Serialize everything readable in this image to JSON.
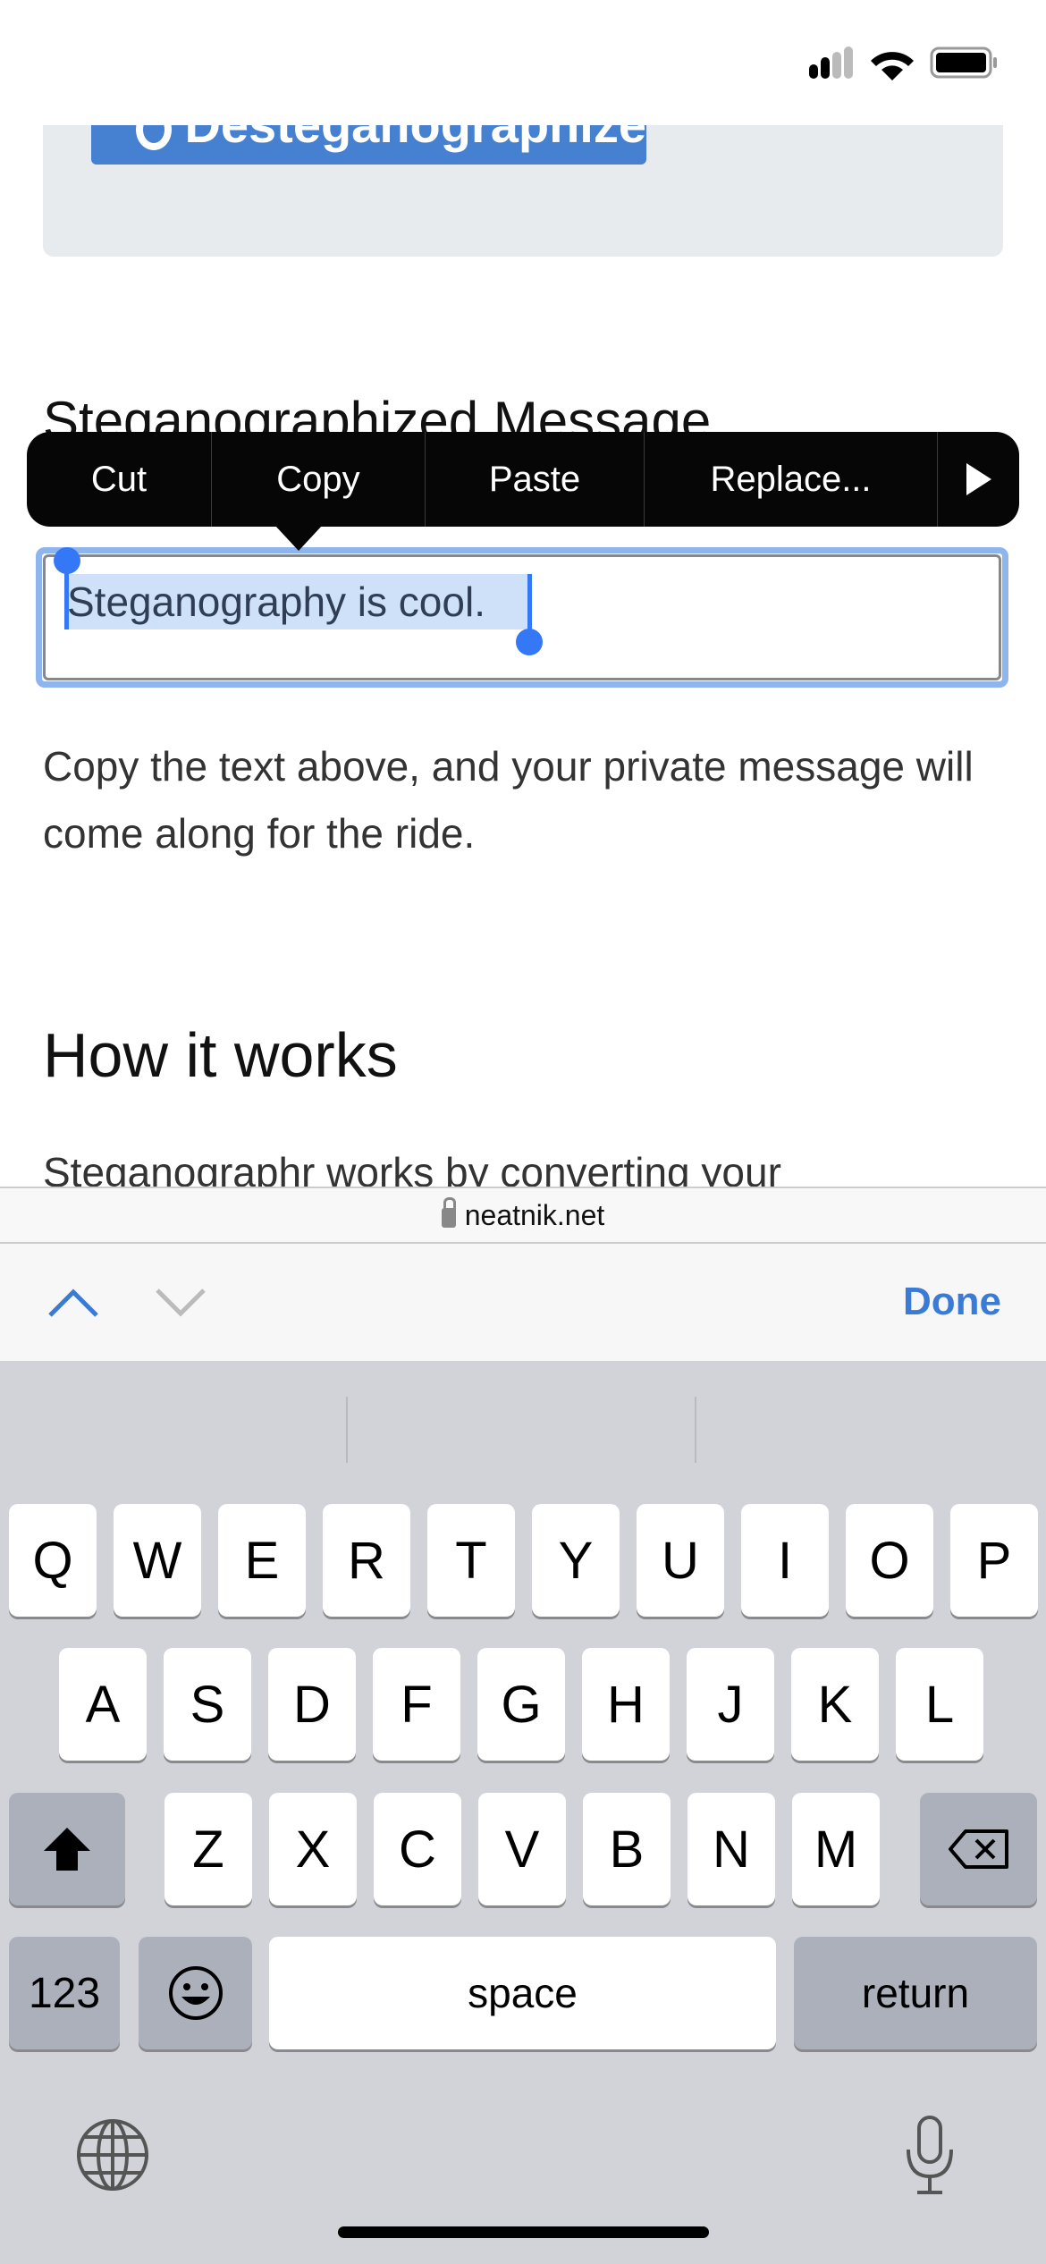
{
  "status_bar": {
    "icons": [
      "signal-icon",
      "wifi-icon",
      "battery-icon"
    ]
  },
  "page": {
    "desteganographize_button": "Desteganographize",
    "heading_message": "Steganographized Message",
    "field_value": "Steganography is cool.",
    "description": "Copy the text above, and your private message will come along for the ride.",
    "heading_how": "How it works",
    "how_text": "Steganographr works by converting your"
  },
  "context_menu": {
    "items": [
      "Cut",
      "Copy",
      "Paste",
      "Replace..."
    ],
    "more_icon": "play-arrow-icon"
  },
  "address_bar": {
    "domain": "neatnik.net",
    "icon": "lock-icon"
  },
  "toolbar": {
    "done": "Done",
    "prev_icon": "chevron-up-icon",
    "next_icon": "chevron-down-icon"
  },
  "keyboard": {
    "row1": [
      "Q",
      "W",
      "E",
      "R",
      "T",
      "Y",
      "U",
      "I",
      "O",
      "P"
    ],
    "row2": [
      "A",
      "S",
      "D",
      "F",
      "G",
      "H",
      "J",
      "K",
      "L"
    ],
    "row3": [
      "Z",
      "X",
      "C",
      "V",
      "B",
      "N",
      "M"
    ],
    "numbers": "123",
    "space": "space",
    "return": "return"
  },
  "colors": {
    "accent": "#3478f6",
    "button": "#4680d1",
    "keyboard_bg": "#d1d3d9"
  }
}
